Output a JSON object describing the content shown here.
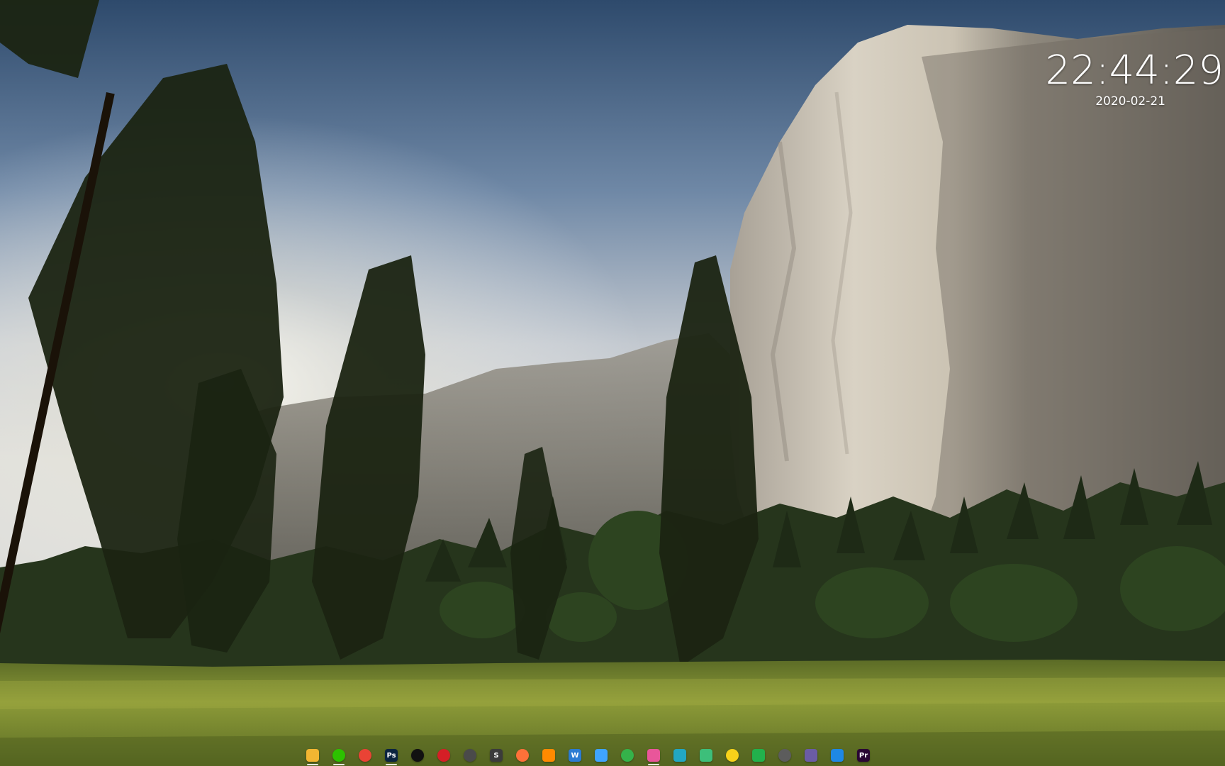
{
  "clock": {
    "time": "22:44:29",
    "date": "2020-02-21"
  },
  "dock": {
    "items": [
      {
        "name": "file-explorer",
        "icon": "folder-icon",
        "glyph": "",
        "color": "#f2b632",
        "running": true
      },
      {
        "name": "wechat",
        "icon": "chat-bubble-icon",
        "glyph": "",
        "color": "#2dc100",
        "running": true
      },
      {
        "name": "chrome",
        "icon": "chrome-icon",
        "glyph": "",
        "color": "#ea4335",
        "running": false
      },
      {
        "name": "photoshop",
        "icon": "photoshop-icon",
        "glyph": "Ps",
        "color": "#0b2440",
        "running": true
      },
      {
        "name": "qq",
        "icon": "penguin-icon",
        "glyph": "",
        "color": "#111111",
        "running": false
      },
      {
        "name": "netease-music",
        "icon": "music-icon",
        "glyph": "",
        "color": "#d51f26",
        "running": false
      },
      {
        "name": "app-circle",
        "icon": "circle-app-icon",
        "glyph": "",
        "color": "#4a4a4a",
        "running": false
      },
      {
        "name": "sublime-text",
        "icon": "sublime-icon",
        "glyph": "S",
        "color": "#3b3b3b",
        "running": false
      },
      {
        "name": "firefox",
        "icon": "firefox-icon",
        "glyph": "",
        "color": "#ff7139",
        "running": false
      },
      {
        "name": "search-tool",
        "icon": "search-icon",
        "glyph": "",
        "color": "#ff8a00",
        "running": false
      },
      {
        "name": "word",
        "icon": "word-icon",
        "glyph": "W",
        "color": "#2b7cd3",
        "running": false
      },
      {
        "name": "notes",
        "icon": "notes-icon",
        "glyph": "",
        "color": "#3fa4ff",
        "running": false
      },
      {
        "name": "app-green",
        "icon": "smile-icon",
        "glyph": "",
        "color": "#35b34a",
        "running": false
      },
      {
        "name": "image-viewer",
        "icon": "image-icon",
        "glyph": "",
        "color": "#e9569a",
        "running": true
      },
      {
        "name": "vscode",
        "icon": "vscode-icon",
        "glyph": "",
        "color": "#22a7c2",
        "running": false
      },
      {
        "name": "design-tool",
        "icon": "palette-icon",
        "glyph": "",
        "color": "#3dbf7a",
        "running": false
      },
      {
        "name": "app-yellow",
        "icon": "yellow-app-icon",
        "glyph": "",
        "color": "#f7d21a",
        "running": false
      },
      {
        "name": "media-player",
        "icon": "play-icon",
        "glyph": "",
        "color": "#22b14c",
        "running": false
      },
      {
        "name": "settings",
        "icon": "gear-icon",
        "glyph": "",
        "color": "#5c5c5c",
        "running": false
      },
      {
        "name": "app-lines",
        "icon": "lines-icon",
        "glyph": "",
        "color": "#6b5ca5",
        "running": false
      },
      {
        "name": "remote-desktop",
        "icon": "remote-icon",
        "glyph": "",
        "color": "#1e88e5",
        "running": false
      },
      {
        "name": "premiere",
        "icon": "premiere-icon",
        "glyph": "Pr",
        "color": "#2a0634",
        "running": false
      }
    ]
  }
}
